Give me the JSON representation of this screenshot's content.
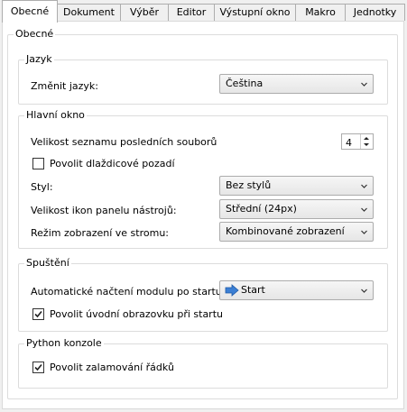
{
  "tabs": [
    "Obecné",
    "Dokument",
    "Výběr",
    "Editor",
    "Výstupní okno",
    "Makro",
    "Jednotky"
  ],
  "panel": {
    "title": "Obecné",
    "language": {
      "title": "Jazyk",
      "label": "Změnit jazyk:",
      "value": "Čeština"
    },
    "main_window": {
      "title": "Hlavní okno",
      "recent_files_label": "Velikost seznamu posledních souborů",
      "recent_files_value": "4",
      "tiled_background_label": "Povolit dlaždicové pozadí",
      "tiled_background_checked": false,
      "style_label": "Styl:",
      "style_value": "Bez stylů",
      "icon_size_label": "Velikost ikon panelu nástrojů:",
      "icon_size_value": "Střední (24px)",
      "tree_mode_label": "Režim zobrazení ve stromu:",
      "tree_mode_value": "Kombinované zobrazení"
    },
    "startup": {
      "title": "Spuštění",
      "autoload_label": "Automatické načtení modulu po startu:",
      "autoload_value": "Start",
      "autoload_icon": "blue-arrow-icon",
      "splash_label": "Povolit úvodní obrazovku při startu",
      "splash_checked": true
    },
    "python": {
      "title": "Python konzole",
      "wrap_label": "Povolit zalamování řádků",
      "wrap_checked": true
    }
  }
}
